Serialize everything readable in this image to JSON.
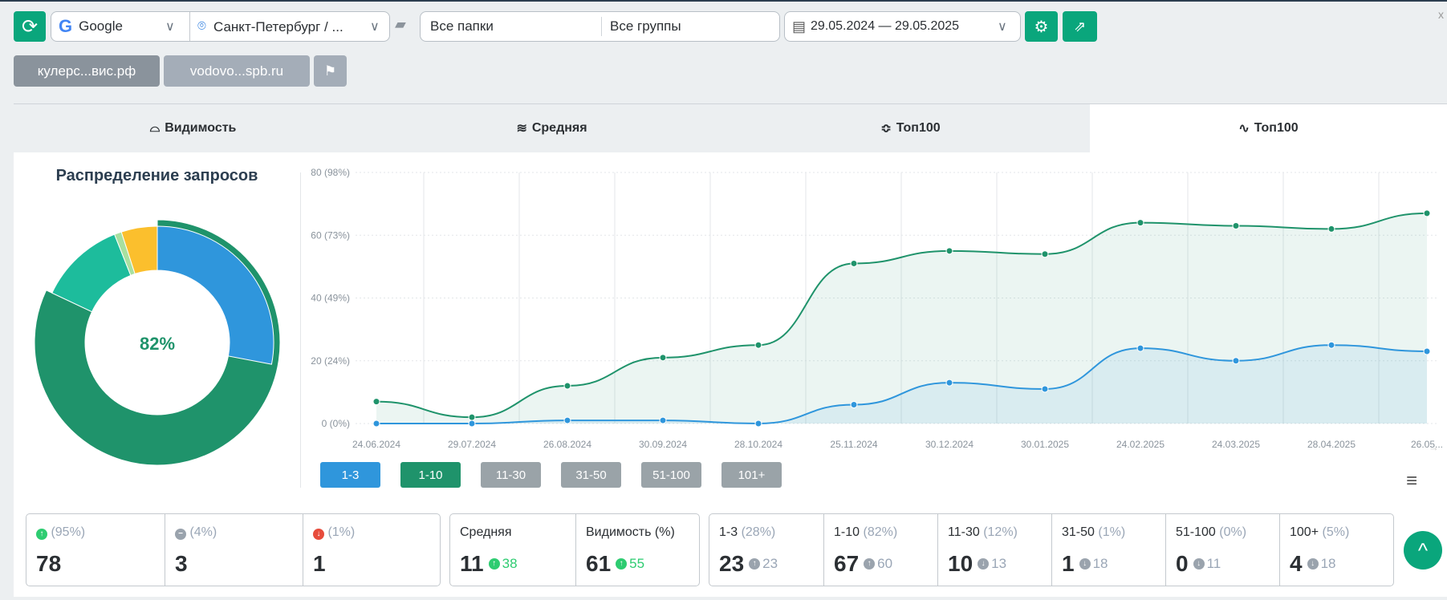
{
  "toolbar": {
    "engine": "Google",
    "region": "Санкт-Петербург / ...",
    "folders": "Все папки",
    "groups": "Все группы",
    "date_range": "29.05.2024 — 29.05.2025"
  },
  "sites": [
    "кулерс...вис.рф",
    "vodovo...spb.ru"
  ],
  "tabs": [
    "Видимость",
    "Средняя",
    "Топ100",
    "Топ100"
  ],
  "donut": {
    "title": "Распределение запросов",
    "center": "82%",
    "slices": [
      {
        "name": "1-3",
        "pct": 28,
        "color": "#2f96dc"
      },
      {
        "name": "1-10",
        "pct": 82,
        "color": "#1f936b"
      },
      {
        "name": "11-30",
        "pct": 12,
        "color": "#1dbc9c"
      },
      {
        "name": "31-50",
        "pct": 1,
        "color": "#a8e0a0"
      },
      {
        "name": "100+",
        "pct": 5,
        "color": "#fbbf2d"
      }
    ]
  },
  "chart_data": {
    "type": "area",
    "x": [
      "24.06.2024",
      "29.07.2024",
      "26.08.2024",
      "30.09.2024",
      "28.10.2024",
      "25.11.2024",
      "30.12.2024",
      "30.01.2025",
      "24.02.2025",
      "24.03.2025",
      "28.04.2025",
      "26.05..."
    ],
    "yticks": [
      "0 (0%)",
      "20 (24%)",
      "40 (49%)",
      "60 (73%)",
      "80 (98%)"
    ],
    "ylim": [
      0,
      80
    ],
    "series": [
      {
        "name": "1-10",
        "color": "#1f936b",
        "values": [
          7,
          2,
          12,
          21,
          25,
          51,
          55,
          54,
          64,
          63,
          62,
          67
        ]
      },
      {
        "name": "1-3",
        "color": "#2f96dc",
        "values": [
          0,
          0,
          1,
          1,
          0,
          6,
          13,
          11,
          24,
          20,
          25,
          23
        ]
      }
    ]
  },
  "range_buttons": [
    {
      "label": "1-3",
      "color": "#2f96dc"
    },
    {
      "label": "1-10",
      "color": "#1f936b"
    },
    {
      "label": "11-30",
      "color": "#9aa3a8"
    },
    {
      "label": "31-50",
      "color": "#9aa3a8"
    },
    {
      "label": "51-100",
      "color": "#9aa3a8"
    },
    {
      "label": "101+",
      "color": "#9aa3a8"
    }
  ],
  "stats": {
    "moves": [
      {
        "pct": "(95%)",
        "value": "78"
      },
      {
        "pct": "(4%)",
        "value": "3"
      },
      {
        "pct": "(1%)",
        "value": "1"
      }
    ],
    "avg": {
      "label": "Средняя",
      "value": "11",
      "delta": "38"
    },
    "vis": {
      "label": "Видимость (%)",
      "value": "61",
      "delta": "55"
    },
    "ranges": [
      {
        "label": "1-3",
        "pct": "(28%)",
        "value": "23",
        "delta": "23",
        "dir": "up"
      },
      {
        "label": "1-10",
        "pct": "(82%)",
        "value": "67",
        "delta": "60",
        "dir": "up"
      },
      {
        "label": "11-30",
        "pct": "(12%)",
        "value": "10",
        "delta": "13",
        "dir": "down"
      },
      {
        "label": "31-50",
        "pct": "(1%)",
        "value": "1",
        "delta": "18",
        "dir": "down"
      },
      {
        "label": "51-100",
        "pct": "(0%)",
        "value": "0",
        "delta": "11",
        "dir": "down"
      },
      {
        "label": "100+",
        "pct": "(5%)",
        "value": "4",
        "delta": "18",
        "dir": "down"
      }
    ]
  }
}
